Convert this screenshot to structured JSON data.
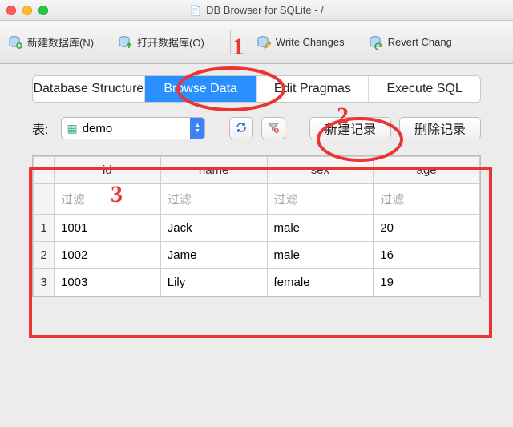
{
  "window": {
    "title": "DB Browser for SQLite - /"
  },
  "toolbar": {
    "new_db": "新建数据库(N)",
    "open_db": "打开数据库(O)",
    "write_changes": "Write Changes",
    "revert_changes": "Revert Chang"
  },
  "tabs": {
    "structure": "Database Structure",
    "browse": "Browse Data",
    "pragmas": "Edit Pragmas",
    "execute": "Execute SQL"
  },
  "controls": {
    "table_label": "表:",
    "selected_table": "demo",
    "new_record": "新建记录",
    "delete_record": "删除记录"
  },
  "table": {
    "filter_placeholder": "过滤",
    "columns": [
      "id",
      "name",
      "sex",
      "age"
    ],
    "rows": [
      {
        "n": "1",
        "id": "1001",
        "name": "Jack",
        "sex": "male",
        "age": "20"
      },
      {
        "n": "2",
        "id": "1002",
        "name": "Jame",
        "sex": "male",
        "age": "16"
      },
      {
        "n": "3",
        "id": "1003",
        "name": "Lily",
        "sex": "female",
        "age": "19"
      }
    ]
  },
  "annotations": {
    "mark1": "1",
    "mark2": "2",
    "mark3": "3"
  }
}
